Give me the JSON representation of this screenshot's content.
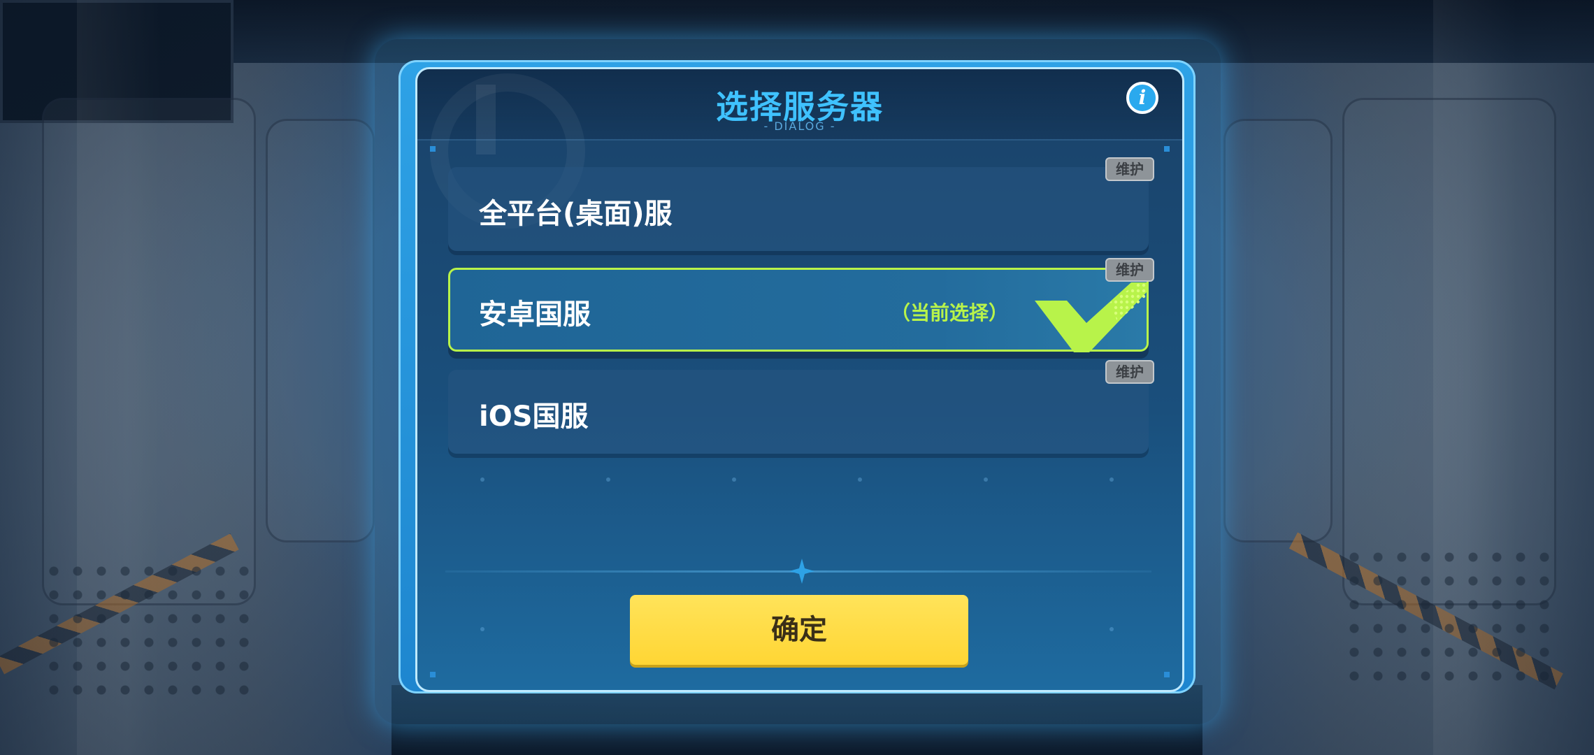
{
  "dialog": {
    "title": "选择服务器",
    "subtitle": "- DIALOG -",
    "info_icon": "info-icon",
    "info_glyph": "i"
  },
  "servers": [
    {
      "name": "全平台(桌面)服",
      "badge": "维护",
      "selected": false
    },
    {
      "name": "安卓国服",
      "badge": "维护",
      "selected": true,
      "current_label": "（当前选择）"
    },
    {
      "name": "iOS国服",
      "badge": "维护",
      "selected": false
    }
  ],
  "confirm_button": {
    "label": "确定"
  },
  "colors": {
    "title": "#3fc2ff",
    "selected_accent": "#b8f34a",
    "confirm_button": "#ffd634",
    "badge": "#8e9499"
  },
  "icons": {
    "check": "check-mark-icon",
    "divider": "star-divider-icon"
  }
}
